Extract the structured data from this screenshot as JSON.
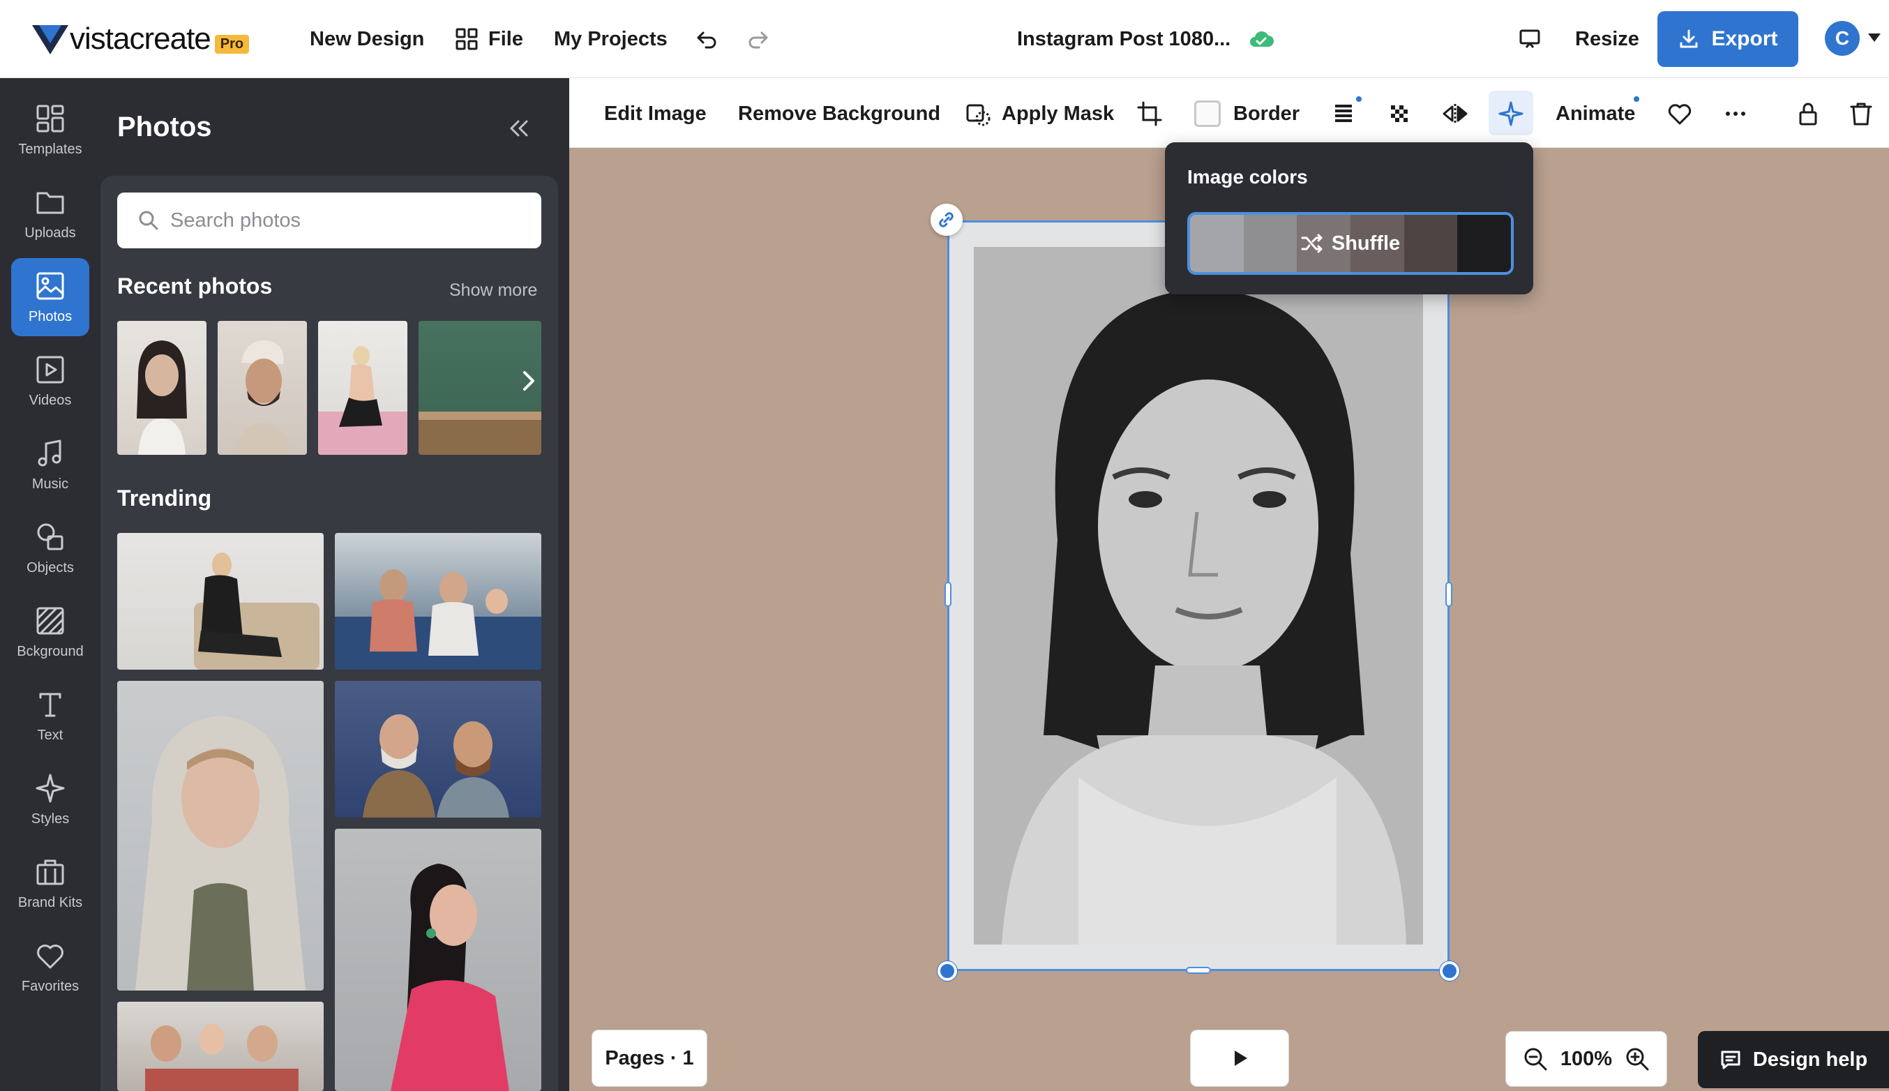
{
  "brand": {
    "name": "vistacreate",
    "badge": "Pro"
  },
  "topbar": {
    "new_design": "New Design",
    "file": "File",
    "my_projects": "My Projects",
    "doc_title": "Instagram Post 1080...",
    "resize": "Resize",
    "export": "Export",
    "avatar_letter": "C"
  },
  "rail": [
    {
      "label": "Templates",
      "icon": "templates-icon"
    },
    {
      "label": "Uploads",
      "icon": "folder-icon"
    },
    {
      "label": "Photos",
      "icon": "image-icon",
      "active": true
    },
    {
      "label": "Videos",
      "icon": "video-icon"
    },
    {
      "label": "Music",
      "icon": "music-icon"
    },
    {
      "label": "Objects",
      "icon": "shapes-icon"
    },
    {
      "label": "Bckground",
      "icon": "background-icon"
    },
    {
      "label": "Text",
      "icon": "text-icon"
    },
    {
      "label": "Styles",
      "icon": "sparkle-icon"
    },
    {
      "label": "Brand Kits",
      "icon": "briefcase-icon"
    },
    {
      "label": "Favorites",
      "icon": "heart-icon"
    }
  ],
  "panel": {
    "title": "Photos",
    "search_placeholder": "Search photos",
    "recent_title": "Recent photos",
    "show_more": "Show more",
    "trending_title": "Trending"
  },
  "toolbar": {
    "edit_image": "Edit Image",
    "remove_background": "Remove Background",
    "apply_mask": "Apply Mask",
    "border": "Border",
    "animate": "Animate"
  },
  "popover": {
    "title": "Image colors",
    "shuffle": "Shuffle",
    "palette": [
      "#a4a5aa",
      "#8f8f92",
      "#7c7375",
      "#6a5d5e",
      "#4f4444",
      "#1d1c1f"
    ]
  },
  "bottom": {
    "pages": "Pages · 1",
    "zoom": "100%",
    "design_help": "Design help"
  },
  "colors": {
    "accent": "#2f75cf",
    "canvas_bg": "#b9a08f",
    "sidebar_bg": "#2c2d33"
  }
}
